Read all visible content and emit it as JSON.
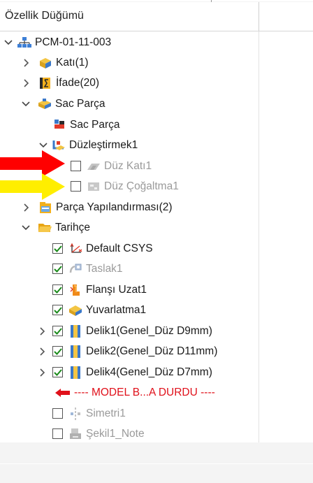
{
  "panel": {
    "title": "Özellik Düğümü"
  },
  "tree": {
    "root": "PCM-01-11-003",
    "kati": "Katı(1)",
    "ifade": "İfade(20)",
    "sac_parca_group": "Sac Parça",
    "sac_parca": "Sac Parça",
    "duzlestirmek": "Düzleştirmek1",
    "duz_kati": "Düz Katı1",
    "duz_cogaltma": "Düz Çoğaltma1",
    "parca_yapilandirmasi": "Parça Yapılandırması(2)",
    "tarihce": "Tarihçe",
    "default_csys": "Default CSYS",
    "taslak": "Taslak1",
    "flansi_uzat": "Flanşı Uzat1",
    "yuvarlatma": "Yuvarlatma1",
    "delik1": "Delik1(Genel_Düz D9mm)",
    "delik2": "Delik2(Genel_Düz D11mm)",
    "delik4": "Delik4(Genel_Düz D7mm)",
    "model_stop": "---- MODEL B...A DURDU ----",
    "simetri": "Simetri1",
    "sekil_note": "Şekil1_Note"
  },
  "colors": {
    "annotation_arrow_1": "#ff0000",
    "annotation_arrow_2": "#ffee00",
    "check_green": "#1a8a1a",
    "stop_red": "#e0101a"
  }
}
